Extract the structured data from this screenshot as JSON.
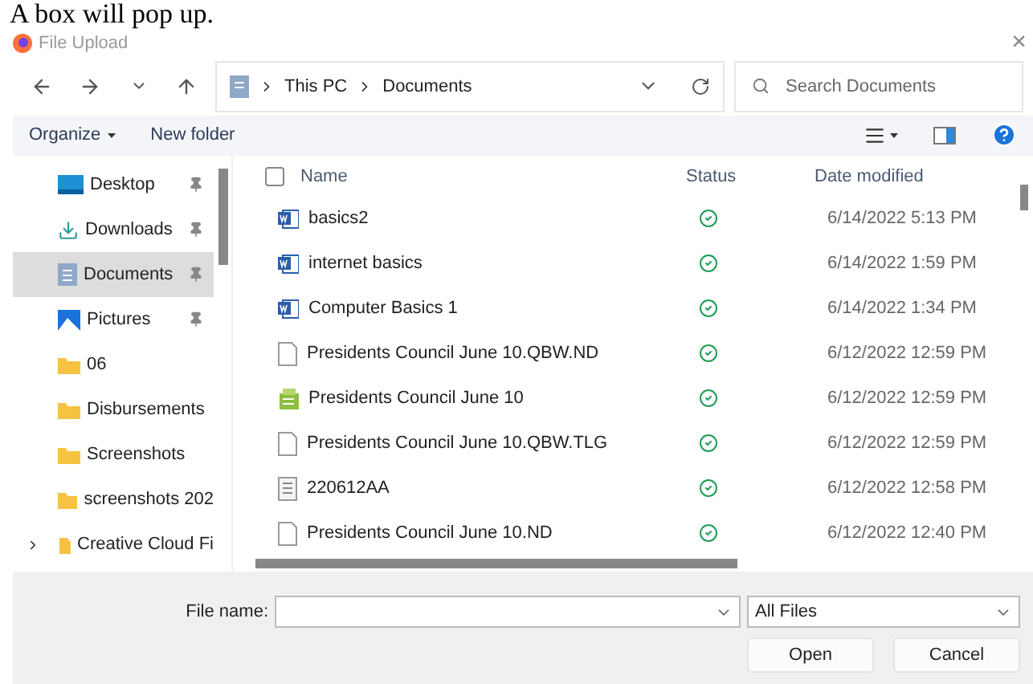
{
  "page_heading": "A box will pop up.",
  "window": {
    "title": "File Upload",
    "close": "×"
  },
  "nav": {
    "breadcrumb": [
      "This PC",
      "Documents"
    ],
    "search": {
      "placeholder": "Search Documents"
    }
  },
  "command_bar": {
    "organize": "Organize",
    "new_folder": "New folder"
  },
  "sidebar": {
    "items": [
      {
        "label": "Desktop",
        "kind": "desktop",
        "pinned": true,
        "selected": false
      },
      {
        "label": "Downloads",
        "kind": "download",
        "pinned": true,
        "selected": false
      },
      {
        "label": "Documents",
        "kind": "documents",
        "pinned": true,
        "selected": true
      },
      {
        "label": "Pictures",
        "kind": "pictures",
        "pinned": true,
        "selected": false
      },
      {
        "label": "06",
        "kind": "folder",
        "pinned": false,
        "selected": false
      },
      {
        "label": "Disbursements",
        "kind": "folder",
        "pinned": false,
        "selected": false
      },
      {
        "label": "Screenshots",
        "kind": "folder",
        "pinned": false,
        "selected": false
      },
      {
        "label": "screenshots 202",
        "kind": "folder",
        "pinned": false,
        "selected": false
      },
      {
        "label": "Creative Cloud Fi",
        "kind": "cloud",
        "pinned": false,
        "selected": false,
        "expanded": false
      }
    ]
  },
  "table": {
    "columns": [
      "Name",
      "Status",
      "Date modified"
    ],
    "select_all": {
      "checked": false
    },
    "rows": [
      {
        "name": "basics2",
        "kind": "word",
        "synced": true,
        "date": "6/14/2022 5:13 PM"
      },
      {
        "name": "internet basics",
        "kind": "word",
        "synced": true,
        "date": "6/14/2022 1:59 PM"
      },
      {
        "name": "Computer Basics 1",
        "kind": "word",
        "synced": true,
        "date": "6/14/2022 1:34 PM"
      },
      {
        "name": "Presidents Council June 10.QBW.ND",
        "kind": "blank",
        "synced": true,
        "date": "6/12/2022 12:59 PM"
      },
      {
        "name": "Presidents Council June 10",
        "kind": "quickbooks",
        "synced": true,
        "date": "6/12/2022 12:59 PM"
      },
      {
        "name": "Presidents Council June 10.QBW.TLG",
        "kind": "blank",
        "synced": true,
        "date": "6/12/2022 12:59 PM"
      },
      {
        "name": "220612AA",
        "kind": "text",
        "synced": true,
        "date": "6/12/2022 12:58 PM"
      },
      {
        "name": "Presidents Council June 10.ND",
        "kind": "blank",
        "synced": true,
        "date": "6/12/2022 12:40 PM"
      }
    ]
  },
  "footer": {
    "file_name_label": "File name:",
    "file_type": "All Files",
    "buttons": [
      "Open",
      "Cancel"
    ]
  }
}
